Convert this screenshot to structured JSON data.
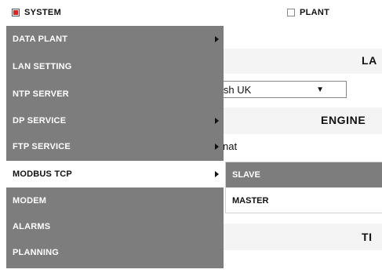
{
  "tabs": [
    {
      "label": "SYSTEM",
      "checked": true
    },
    {
      "label": "PLANT",
      "checked": false
    }
  ],
  "background": {
    "section1_title": "LA",
    "select_value": "ish UK",
    "select_arrow": "▼",
    "section2_title": "ENGINE",
    "date_format_fragment": "nat",
    "section3_title": "TI"
  },
  "menu": {
    "items": [
      {
        "label": "DATA PLANT",
        "has_submenu": true
      },
      {
        "label": "LAN SETTING",
        "has_submenu": false
      },
      {
        "label": "NTP SERVER",
        "has_submenu": false
      },
      {
        "label": "DP SERVICE",
        "has_submenu": true
      },
      {
        "label": "FTP SERVICE",
        "has_submenu": true
      },
      {
        "label": "MODBUS TCP",
        "has_submenu": true,
        "active": true
      },
      {
        "label": "MODEM",
        "has_submenu": false
      },
      {
        "label": "ALARMS",
        "has_submenu": false
      },
      {
        "label": "PLANNING",
        "has_submenu": false
      }
    ]
  },
  "submenu": {
    "items": [
      {
        "label": "SLAVE",
        "highlighted": true
      },
      {
        "label": "MASTER",
        "highlighted": false
      }
    ]
  },
  "colors": {
    "menu_bg": "#7d7d7d",
    "checkbox_checked": "#e02020"
  }
}
